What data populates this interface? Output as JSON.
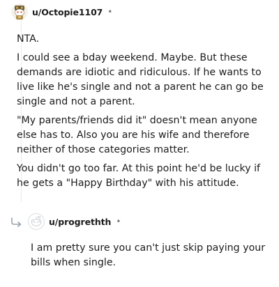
{
  "comments": [
    {
      "username": "u/Octopie1107",
      "separator": "•",
      "avatar_icon": "snoo-avatar-costume-icon",
      "paragraphs": [
        "NTA.",
        "I could see a bday weekend. Maybe. But these demands are idiotic and ridiculous. If he wants to live like he's single and not a parent he can go be single and not a parent.",
        "\"My parents/friends did it\" doesn't mean anyone else has to. Also you are his wife and therefore neither of those categories matter.",
        "You didn't go too far. At this point he'd be lucky if he gets a \"Happy Birthday\" with his attitude."
      ]
    },
    {
      "username": "u/progrethth",
      "separator": "•",
      "avatar_icon": "default-snoo-avatar-icon",
      "reply_icon": "reply-arrow-icon",
      "paragraphs": [
        "I am pretty sure you can't just skip paying your bills when single."
      ]
    }
  ],
  "colors": {
    "text": "#1c1c1c",
    "meta": "#7c7c7c",
    "thread_line": "#e9ebed",
    "reply_arrow": "#9aa3ad"
  }
}
